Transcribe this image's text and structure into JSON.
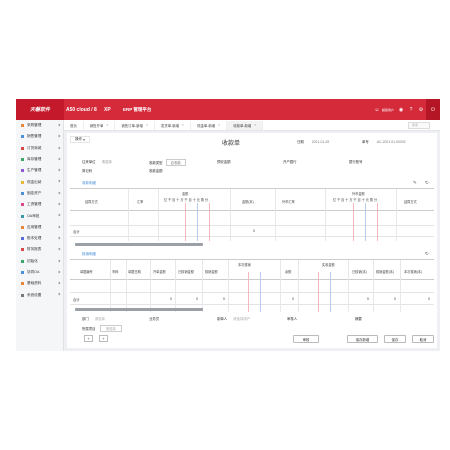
{
  "topbar": {
    "logo": "天磐软件",
    "system": "A50 cloud / 8",
    "xp": "XP",
    "erp": "ERP 管理平台",
    "user": "超级用户",
    "icons": [
      "user-icon",
      "bell-icon",
      "help-icon",
      "gear-icon",
      "power-icon"
    ],
    "colors": {
      "brand": "#d42a3a",
      "logo_bg": "#c4192b"
    }
  },
  "sidebar": {
    "items": [
      {
        "label": "采购管理",
        "icon": "cart-icon",
        "color": "#e8873a"
      },
      {
        "label": "销售管理",
        "icon": "sales-icon",
        "color": "#4a8fd8"
      },
      {
        "label": "订货商城",
        "icon": "shop-icon",
        "color": "#d84a4a"
      },
      {
        "label": "库存管理",
        "icon": "box-icon",
        "color": "#3aa86a"
      },
      {
        "label": "生产管理",
        "icon": "factory-icon",
        "color": "#8a5ad8"
      },
      {
        "label": "现金出纳",
        "icon": "cash-icon",
        "color": "#e8b83a"
      },
      {
        "label": "固定资产",
        "icon": "asset-icon",
        "color": "#4a8fd8"
      },
      {
        "label": "工资管理",
        "icon": "wage-icon",
        "color": "#d84a8a"
      },
      {
        "label": "OA审批",
        "icon": "oa-icon",
        "color": "#3a98a8"
      },
      {
        "label": "应用管理",
        "icon": "app-icon",
        "color": "#e8873a"
      },
      {
        "label": "账本处理",
        "icon": "ledger-icon",
        "color": "#5a6ad8"
      },
      {
        "label": "财务报表",
        "icon": "report-icon",
        "color": "#d84a4a"
      },
      {
        "label": "初始化",
        "icon": "init-icon",
        "color": "#3aa86a"
      },
      {
        "label": "协同OA",
        "icon": "team-icon",
        "color": "#4a8fd8"
      },
      {
        "label": "基础资料",
        "icon": "data-icon",
        "color": "#e8873a"
      },
      {
        "label": "系统设置",
        "icon": "settings-icon",
        "color": "#777777"
      }
    ]
  },
  "tabs": {
    "items": [
      {
        "label": "首页",
        "active": false
      },
      {
        "label": "销售开单",
        "active": false
      },
      {
        "label": "销售订单-新增",
        "active": false
      },
      {
        "label": "发货单-新增",
        "active": false
      },
      {
        "label": "现金单-新增",
        "active": false
      },
      {
        "label": "收款单-新增",
        "active": true
      }
    ],
    "search_placeholder": "搜索"
  },
  "form": {
    "ops": "操作",
    "title": "收款单",
    "date_label": "日期",
    "date_value": "2021-01-28",
    "no_label": "单号",
    "no_value": "AC-2021-01-00002",
    "customer_label": "往来单位",
    "customer_value": "请选择",
    "method_label": "收款类型",
    "method_value": "应收款",
    "prepay_label": "预收金额",
    "account_label": "开户银行",
    "bank_label": "银行账号",
    "contact_label": "简记码",
    "amount_label": "收款金额"
  },
  "section1": {
    "title": "收款明细",
    "cols": [
      "结算方式",
      "帐号",
      "汇率",
      "金额",
      "金额(本)",
      "外币汇率",
      "外币金额",
      "结算方式"
    ],
    "digits": "亿千百十万千百十元角分",
    "total_label": "合计",
    "total_value": "0"
  },
  "section2": {
    "title": "核销明细",
    "cols": [
      "单据编号",
      "币种",
      "单据日期",
      "开单金额",
      "已核销金额",
      "核销金额",
      "本次核销",
      "余额",
      "实收金额",
      "已核销(本)",
      "核销金额(本)",
      "本次核销(本)"
    ],
    "total_label": "合计",
    "zeros": [
      "0",
      "0",
      "0",
      "0",
      "0",
      "0",
      "0"
    ]
  },
  "bottom": {
    "dept_label": "部门",
    "dept_ph": "请选择",
    "staff_label": "业务员",
    "creator_label": "制单人",
    "creator_ph": "请选择用户",
    "reviewer_label": "审核人",
    "remark_label": "摘要",
    "project_label": "所属项目",
    "project_value": "请选择"
  },
  "actions": {
    "add": "+",
    "plus": "+",
    "audit": "审核",
    "save_new": "保存新增",
    "save": "保存",
    "cancel": "取消"
  }
}
